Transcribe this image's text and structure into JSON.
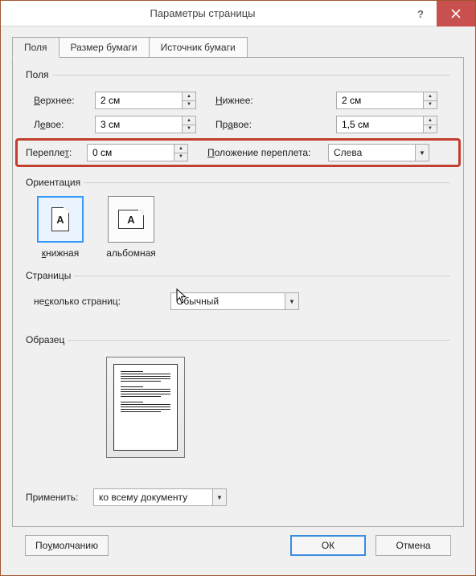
{
  "titlebar": {
    "title": "Параметры страницы"
  },
  "tabs": {
    "fields": "Поля",
    "paper_size": "Размер бумаги",
    "paper_source": "Источник бумаги"
  },
  "groups": {
    "fields": "Поля",
    "orientation": "Ориентация",
    "pages": "Страницы",
    "preview": "Образец"
  },
  "margins": {
    "top_label": "Верхнее:",
    "top_value": "2 см",
    "bottom_label": "Нижнее:",
    "bottom_value": "2 см",
    "left_label": "Левое:",
    "left_value": "3 см",
    "right_label": "Правое:",
    "right_value": "1,5 см",
    "gutter_label": "Переплет:",
    "gutter_value": "0 см",
    "gutter_pos_label": "Положение переплета:",
    "gutter_pos_value": "Слева"
  },
  "orientation": {
    "portrait": "книжная",
    "landscape": "альбомная",
    "glyph": "А"
  },
  "pages": {
    "label": "несколько страниц:",
    "value": "Обычный"
  },
  "apply": {
    "label": "Применить:",
    "value": "ко всему документу"
  },
  "buttons": {
    "default": "По умолчанию",
    "ok": "ОК",
    "cancel": "Отмена"
  }
}
